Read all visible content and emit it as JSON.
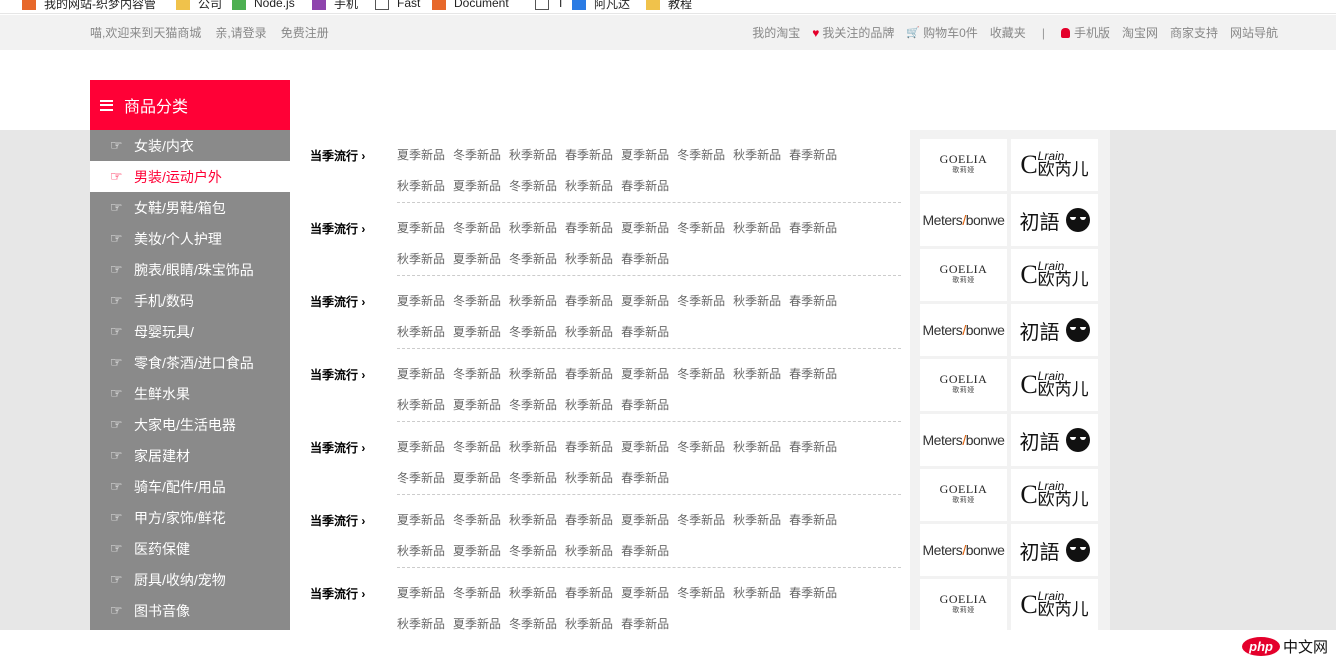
{
  "bookmarks": [
    {
      "label": "我的网站-织梦内容管",
      "icon": "orange-diamond-icon"
    },
    {
      "label": "公司",
      "icon": "folder-icon"
    },
    {
      "label": "Node.js",
      "icon": "green-hexagon-icon"
    },
    {
      "label": "手机",
      "icon": "purple-logo-icon"
    },
    {
      "label": "Fast",
      "icon": "page-icon"
    },
    {
      "label": "Document",
      "icon": "orange-diamond-icon"
    },
    {
      "label": "T",
      "icon": "page-icon"
    },
    {
      "label": "阿凡达",
      "icon": "blue-logo-icon"
    },
    {
      "label": "教程",
      "icon": "folder-icon"
    }
  ],
  "topbar": {
    "welcome": "喵,欢迎来到天猫商城",
    "login": "亲,请登录",
    "register": "免费注册",
    "my_taobao": "我的淘宝",
    "brands_followed": "我关注的品牌",
    "cart": "购物车0件",
    "favorites": "收藏夹",
    "separator": "|",
    "mobile": "手机版",
    "taobao": "淘宝网",
    "merchant": "商家支持",
    "site_nav": "网站导航"
  },
  "category": {
    "title": "商品分类",
    "items": [
      "女装/内衣",
      "男装/运动户外",
      "女鞋/男鞋/箱包",
      "美妆/个人护理",
      "腕表/眼睛/珠宝饰品",
      "手机/数码",
      "母婴玩具/",
      "零食/茶酒/进口食品",
      "生鲜水果",
      "大家电/生活电器",
      "家居建材",
      "骑车/配件/用品",
      "甲方/家饰/鲜花",
      "医药保健",
      "厨具/收纳/宠物",
      "图书音像"
    ],
    "active_index": 1
  },
  "panel": {
    "rows": [
      {
        "title": "当季流行 ›",
        "links": [
          "夏季新品",
          "冬季新品",
          "秋季新品",
          "春季新品",
          "夏季新品",
          "冬季新品",
          "秋季新品",
          "春季新品",
          "秋季新品",
          "夏季新品",
          "冬季新品",
          "秋季新品",
          "春季新品"
        ]
      },
      {
        "title": "当季流行 ›",
        "links": [
          "夏季新品",
          "冬季新品",
          "秋季新品",
          "春季新品",
          "夏季新品",
          "冬季新品",
          "秋季新品",
          "春季新品",
          "秋季新品",
          "夏季新品",
          "冬季新品",
          "秋季新品",
          "春季新品"
        ]
      },
      {
        "title": "当季流行 ›",
        "links": [
          "夏季新品",
          "冬季新品",
          "秋季新品",
          "春季新品",
          "夏季新品",
          "冬季新品",
          "秋季新品",
          "春季新品",
          "秋季新品",
          "夏季新品",
          "冬季新品",
          "秋季新品",
          "春季新品"
        ]
      },
      {
        "title": "当季流行 ›",
        "links": [
          "夏季新品",
          "冬季新品",
          "秋季新品",
          "春季新品",
          "夏季新品",
          "冬季新品",
          "秋季新品",
          "春季新品",
          "秋季新品",
          "夏季新品",
          "冬季新品",
          "秋季新品",
          "春季新品"
        ]
      },
      {
        "title": "当季流行 ›",
        "links": [
          "夏季新品",
          "冬季新品",
          "秋季新品",
          "春季新品",
          "夏季新品",
          "冬季新品",
          "秋季新品",
          "春季新品",
          "冬季新品",
          "夏季新品",
          "冬季新品",
          "秋季新品",
          "春季新品"
        ]
      },
      {
        "title": "当季流行 ›",
        "links": [
          "夏季新品",
          "冬季新品",
          "秋季新品",
          "春季新品",
          "夏季新品",
          "冬季新品",
          "秋季新品",
          "春季新品",
          "秋季新品",
          "夏季新品",
          "冬季新品",
          "秋季新品",
          "春季新品"
        ]
      },
      {
        "title": "当季流行 ›",
        "links": [
          "夏季新品",
          "冬季新品",
          "秋季新品",
          "春季新品",
          "夏季新品",
          "冬季新品",
          "秋季新品",
          "春季新品",
          "秋季新品",
          "夏季新品",
          "冬季新品",
          "秋季新品",
          "春季新品"
        ]
      }
    ]
  },
  "brands": {
    "goelia": {
      "name": "GOELIA",
      "cn": "歌莉娅"
    },
    "clrain": {
      "c": "C",
      "l": "Lrain",
      "cn": "欧芮儿"
    },
    "metersbonwe": {
      "a": "Meters",
      "slash": "/",
      "b": "bonwe"
    },
    "chuyu": {
      "cn": "初語"
    }
  },
  "watermark": {
    "php": "php",
    "cn": "中文网"
  },
  "colors": {
    "accent": "#ff0036",
    "sidebar": "#8a8a8a",
    "band": "#e7e7e7"
  }
}
